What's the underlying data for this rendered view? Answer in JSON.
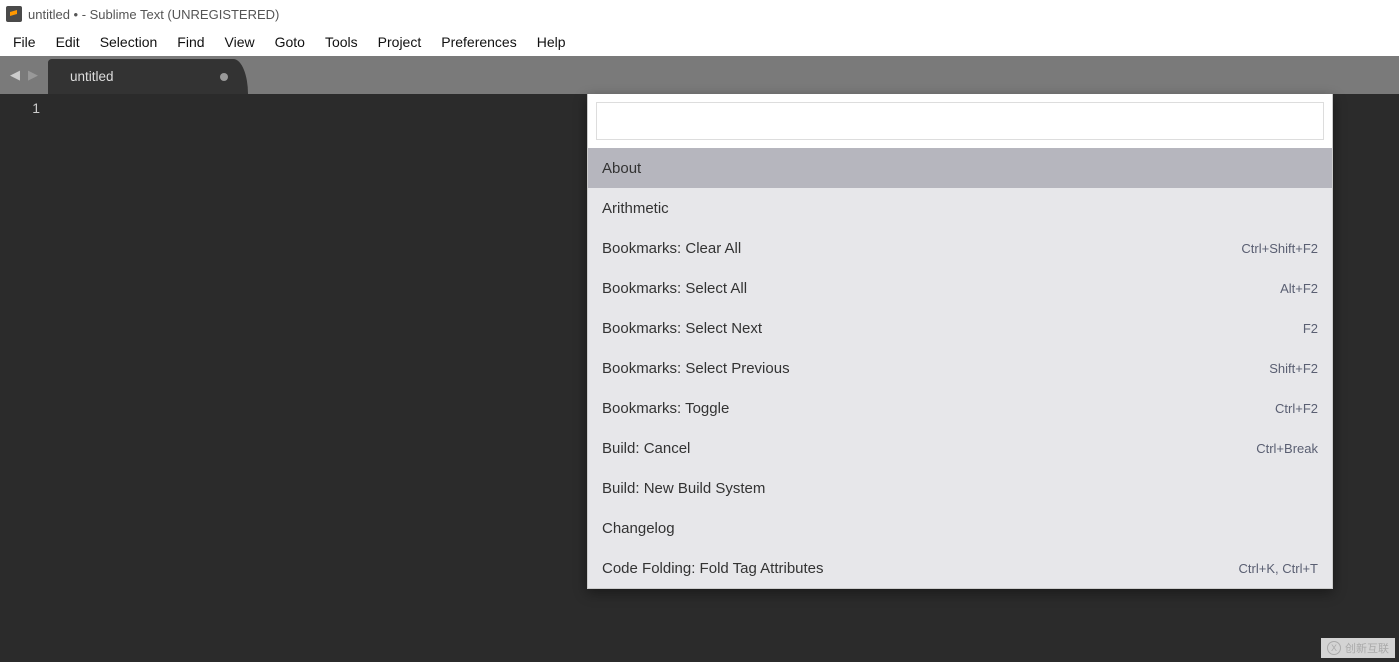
{
  "title_bar": {
    "text": "untitled • - Sublime Text (UNREGISTERED)"
  },
  "menu": {
    "items": [
      "File",
      "Edit",
      "Selection",
      "Find",
      "View",
      "Goto",
      "Tools",
      "Project",
      "Preferences",
      "Help"
    ]
  },
  "tabs": {
    "active": {
      "label": "untitled",
      "dirty": true
    }
  },
  "gutter": {
    "line1": "1"
  },
  "palette": {
    "input_value": "",
    "items": [
      {
        "label": "About",
        "shortcut": "",
        "selected": true
      },
      {
        "label": "Arithmetic",
        "shortcut": ""
      },
      {
        "label": "Bookmarks: Clear All",
        "shortcut": "Ctrl+Shift+F2"
      },
      {
        "label": "Bookmarks: Select All",
        "shortcut": "Alt+F2"
      },
      {
        "label": "Bookmarks: Select Next",
        "shortcut": "F2"
      },
      {
        "label": "Bookmarks: Select Previous",
        "shortcut": "Shift+F2"
      },
      {
        "label": "Bookmarks: Toggle",
        "shortcut": "Ctrl+F2"
      },
      {
        "label": "Build: Cancel",
        "shortcut": "Ctrl+Break"
      },
      {
        "label": "Build: New Build System",
        "shortcut": ""
      },
      {
        "label": "Changelog",
        "shortcut": ""
      },
      {
        "label": "Code Folding: Fold Tag Attributes",
        "shortcut": "Ctrl+K, Ctrl+T"
      }
    ]
  },
  "watermark": {
    "text": "创新互联"
  }
}
